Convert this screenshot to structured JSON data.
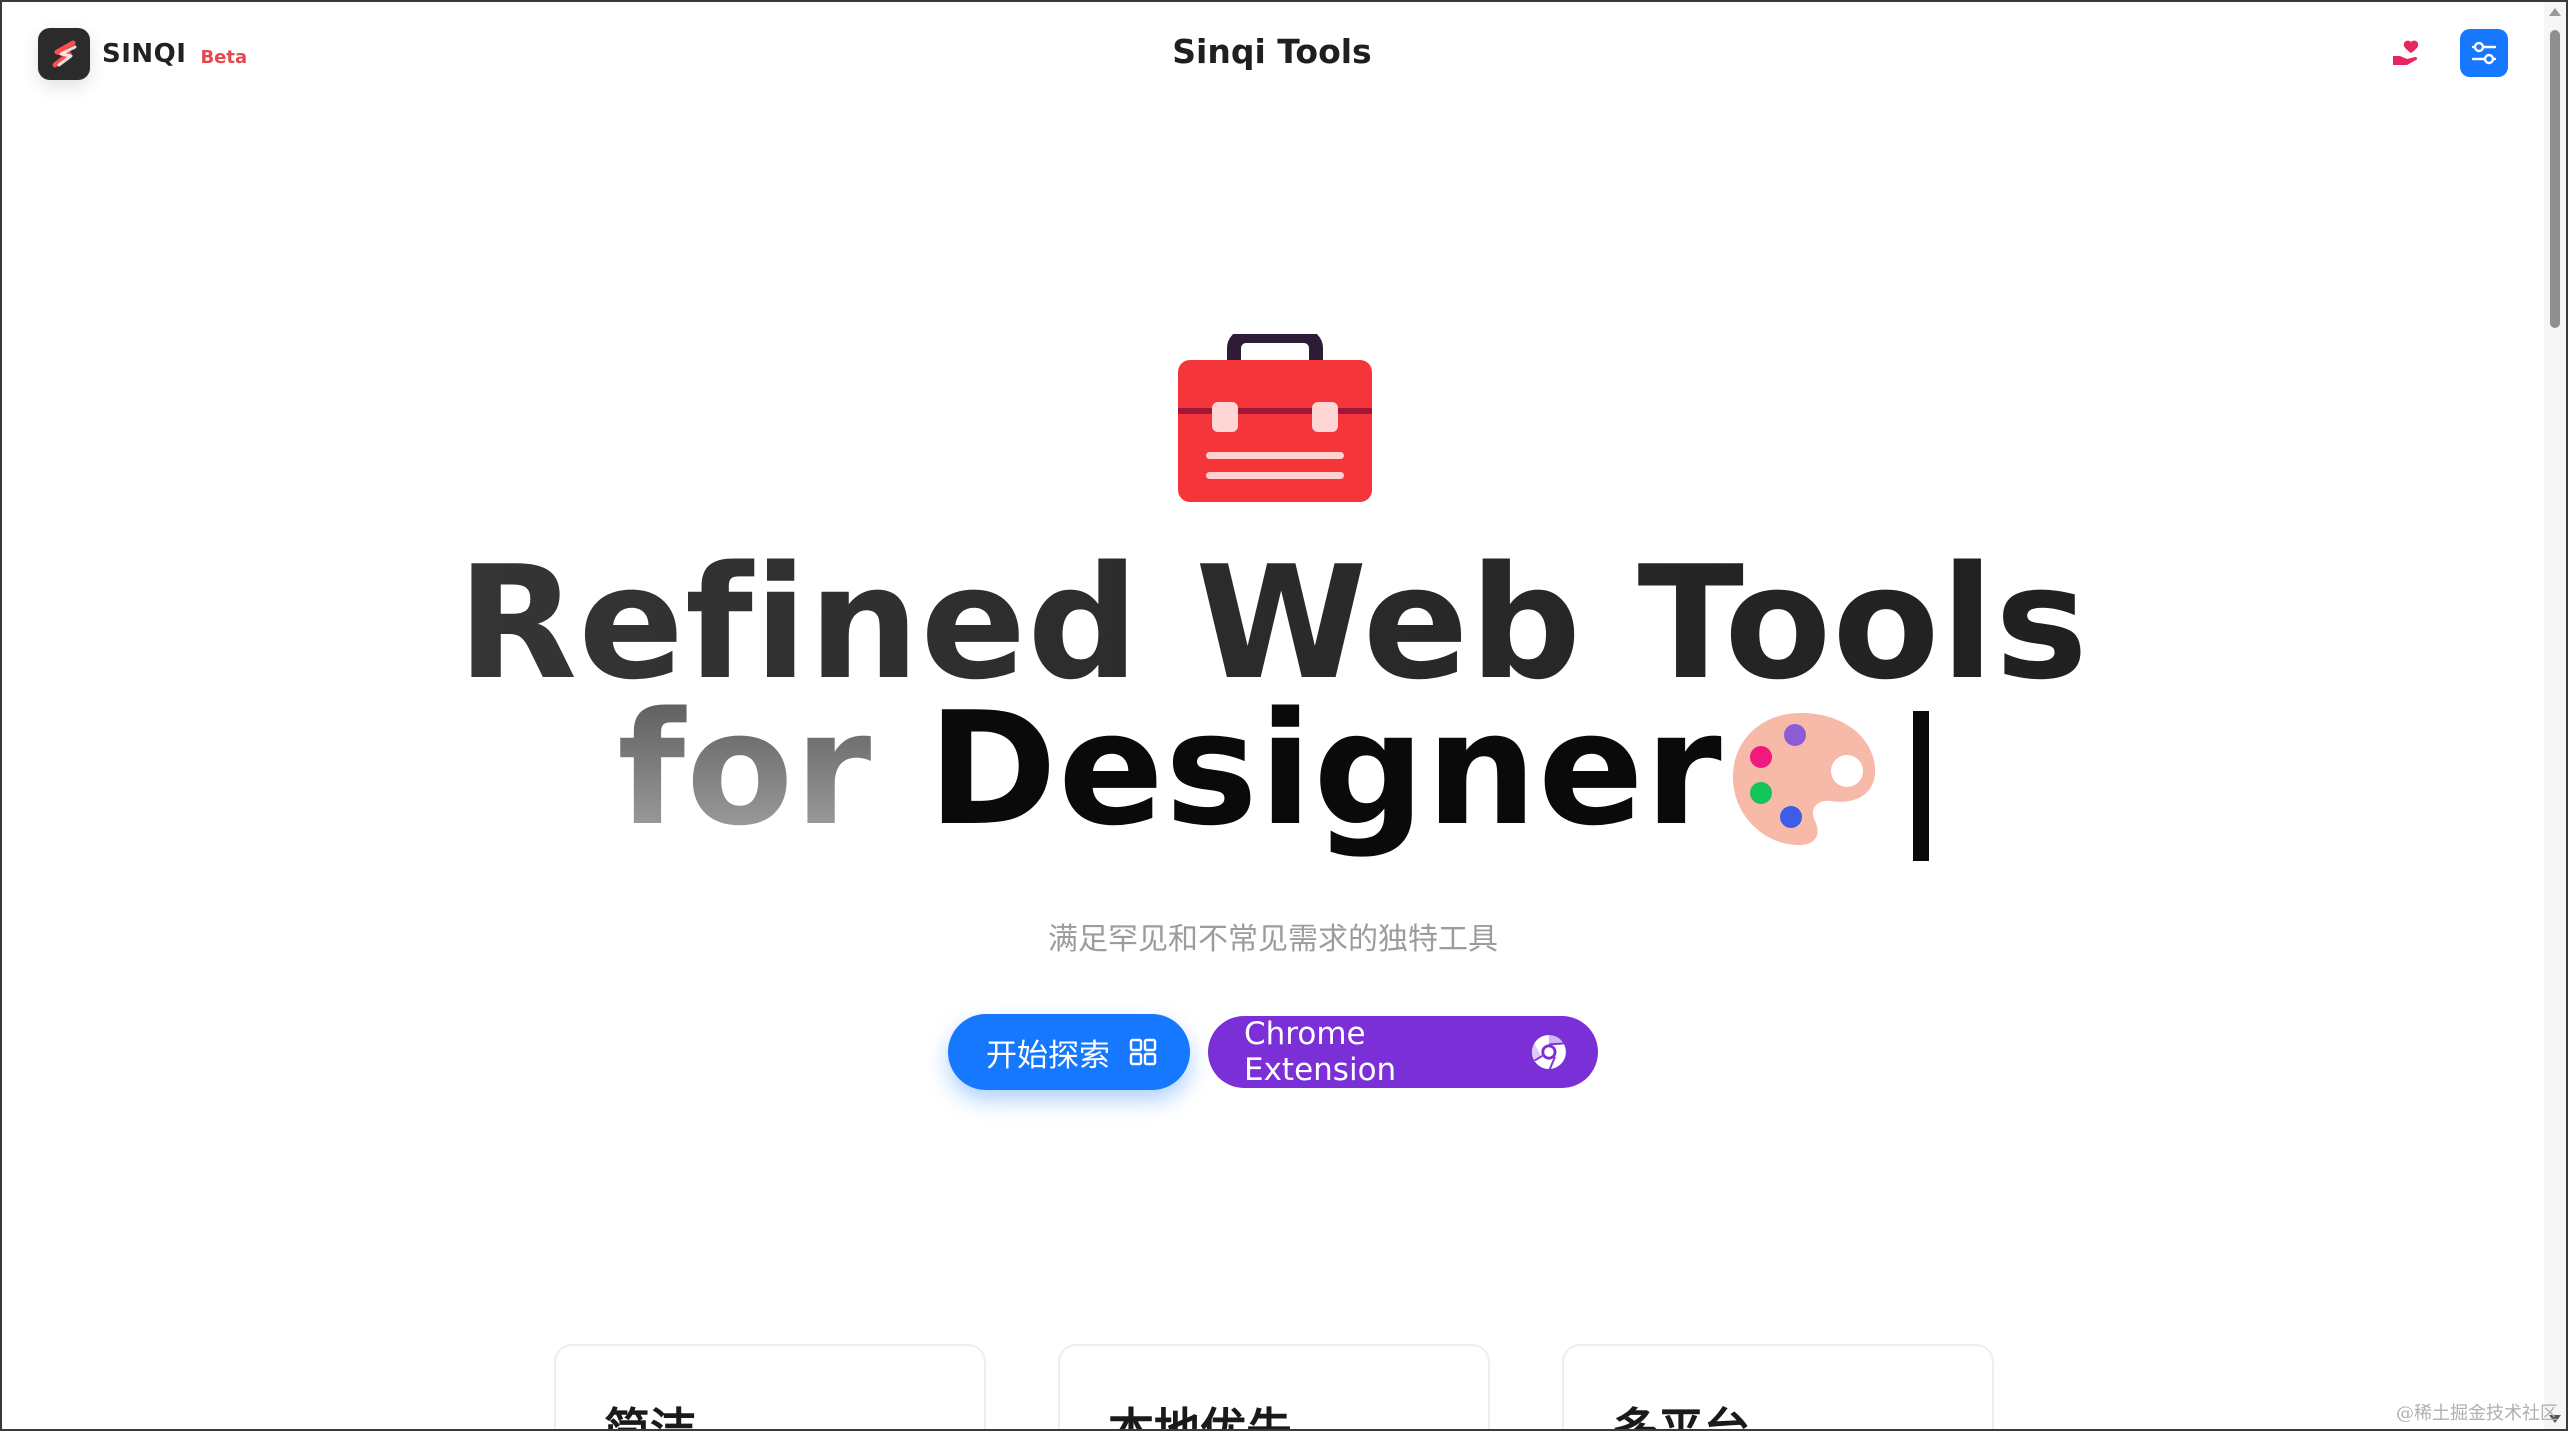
{
  "header": {
    "brand_name": "SINQI",
    "brand_badge": "Beta",
    "site_title": "Sinqi Tools",
    "icons": {
      "logo": "sinqi-logo-icon",
      "donate": "heart-hand-icon",
      "settings": "settings-sliders-icon"
    }
  },
  "hero": {
    "line1": "Refined Web Tools",
    "line2_prefix": "for",
    "line2_word": "Designer",
    "subtitle": "满足罕见和不常见需求的独特工具",
    "icons": {
      "toolbox": "toolbox-icon",
      "palette": "artist-palette-icon"
    }
  },
  "buttons": {
    "explore_label": "开始探索",
    "chrome_label": "Chrome Extension"
  },
  "features": [
    {
      "title": "简洁"
    },
    {
      "title": "本地优先"
    },
    {
      "title": "多平台"
    }
  ],
  "watermark": "@稀土掘金技术社区",
  "colors": {
    "primary": "#1677ff",
    "chrome_button": "#7b2fd6",
    "beta_badge": "#e5484d",
    "toolbox": "#f4363a"
  }
}
